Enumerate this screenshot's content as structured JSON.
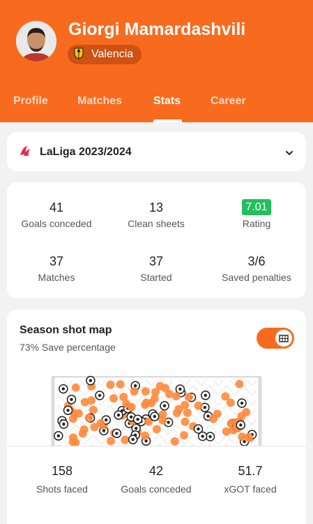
{
  "player": {
    "name": "Giorgi Mamardashvili",
    "team": "Valencia"
  },
  "tabs": [
    {
      "label": "Profile",
      "active": false
    },
    {
      "label": "Matches",
      "active": false
    },
    {
      "label": "Stats",
      "active": true
    },
    {
      "label": "Career",
      "active": false
    }
  ],
  "league": {
    "name": "LaLiga 2023/2024"
  },
  "stats": {
    "goals_conceded": {
      "value": "41",
      "label": "Goals conceded"
    },
    "clean_sheets": {
      "value": "13",
      "label": "Clean sheets"
    },
    "rating": {
      "value": "7.01",
      "label": "Rating"
    },
    "matches": {
      "value": "37",
      "label": "Matches"
    },
    "started": {
      "value": "37",
      "label": "Started"
    },
    "saved_penalties": {
      "value": "3/6",
      "label": "Saved penalties"
    }
  },
  "shot_map": {
    "title": "Season shot map",
    "subtitle": "73% Save percentage",
    "toggle_on": true,
    "shots_faced": {
      "value": "158",
      "label": "Shots faced"
    },
    "goals_conceded": {
      "value": "42",
      "label": "Goals conceded"
    },
    "xgot_faced": {
      "value": "51.7",
      "label": "xGOT faced"
    }
  },
  "colors": {
    "brand": "#f86b1f",
    "brand_dark": "#cd5214",
    "rating_green": "#21c05a",
    "goal_marker": "#ff8a3d",
    "save_marker": "#222222"
  },
  "icons": {
    "league": "laliga-logo-icon",
    "team": "valencia-crest-icon",
    "dropdown": "chevron-down-icon",
    "toggle": "goal-net-icon"
  }
}
